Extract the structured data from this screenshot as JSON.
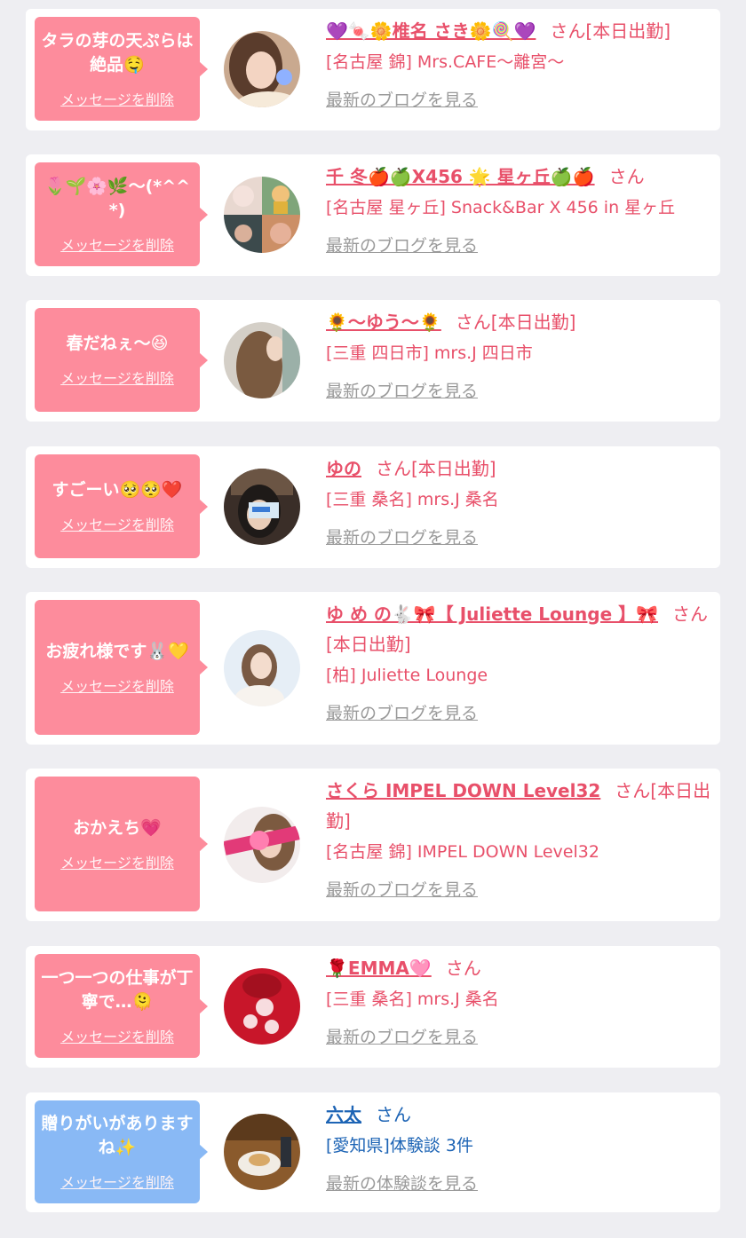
{
  "delete_label": "メッセージを削除",
  "colors": {
    "bubble_pink": "#fd8c9c",
    "bubble_blue": "#89b9f5",
    "name_pink": "#e8506a",
    "name_blue": "#1d64b5",
    "link_gray": "#9a9a9a",
    "page_bg": "#eeeef2"
  },
  "messages": [
    {
      "message": "タラの芽の天ぷらは絶品🤤",
      "name": "💜🍬🌼椎名 さき🌼🍭💜",
      "suffix": "さん[本日出勤]",
      "shop": "[名古屋 錦] Mrs.CAFE〜離宮〜",
      "link": "最新のブログを見る"
    },
    {
      "message": "🌷🌱🌸🌿〜(*^^*)",
      "name": "千 冬🍎🍏X456 🌟 星ヶ丘🍏🍎",
      "suffix": "さん",
      "shop": "[名古屋 星ヶ丘] Snack&Bar X 456 in 星ヶ丘",
      "link": "最新のブログを見る"
    },
    {
      "message": "春だねぇ〜😆",
      "name": "🌻〜ゆう〜🌻",
      "suffix": "さん[本日出勤]",
      "shop": "[三重 四日市] mrs.J 四日市",
      "link": "最新のブログを見る"
    },
    {
      "message": "すごーい🥺🥺❤️",
      "name": "ゆの",
      "suffix": "さん[本日出勤]",
      "shop": "[三重 桑名] mrs.J 桑名",
      "link": "最新のブログを見る"
    },
    {
      "message": "お疲れ様です🐰💛",
      "name": "ゆ め の🐇🎀【 Juliette Lounge 】🎀",
      "suffix": "さん[本日出勤]",
      "shop": "[柏] Juliette Lounge",
      "link": "最新のブログを見る"
    },
    {
      "message": "おかえち💗",
      "name": "さくら IMPEL DOWN Level32",
      "suffix": "さん[本日出勤]",
      "shop": "[名古屋 錦] IMPEL DOWN Level32",
      "link": "最新のブログを見る"
    },
    {
      "message": "一つ一つの仕事が丁寧で…🫠",
      "name": "🌹EMMA🩷",
      "suffix": "さん",
      "shop": "[三重 桑名] mrs.J 桑名",
      "link": "最新のブログを見る"
    },
    {
      "message": "贈りがいがありますね✨",
      "name": "六太",
      "suffix": "さん",
      "shop": "[愛知県]体験談 3件",
      "link": "最新の体験談を見る"
    }
  ]
}
